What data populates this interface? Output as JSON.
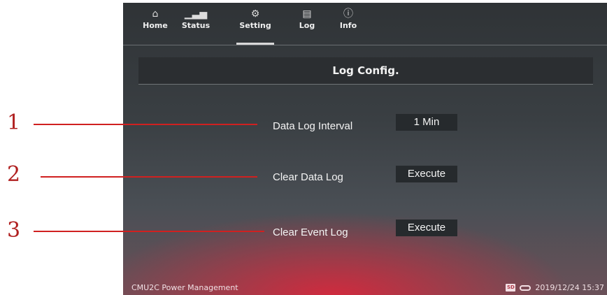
{
  "nav": {
    "items": [
      {
        "label": "Home",
        "icon": "home-icon"
      },
      {
        "label": "Status",
        "icon": "bar-chart-icon"
      },
      {
        "label": "Setting",
        "icon": "gear-icon"
      },
      {
        "label": "Log",
        "icon": "folder-icon"
      },
      {
        "label": "Info",
        "icon": "info-icon"
      }
    ],
    "active": "Setting"
  },
  "panel": {
    "title": "Log Config.",
    "rows": [
      {
        "label": "Data Log Interval",
        "value": "1 Min"
      },
      {
        "label": "Clear Data Log",
        "value": "Execute"
      },
      {
        "label": "Clear Event Log",
        "value": "Execute"
      }
    ]
  },
  "status_bar": {
    "app_name": "CMU2C Power Management",
    "sd_label": "SD",
    "datetime": "2019/12/24 15:37"
  },
  "callouts": [
    "1",
    "2",
    "3"
  ],
  "colors": {
    "accent_red": "#d02020",
    "panel_dark": "#2b2e31"
  }
}
